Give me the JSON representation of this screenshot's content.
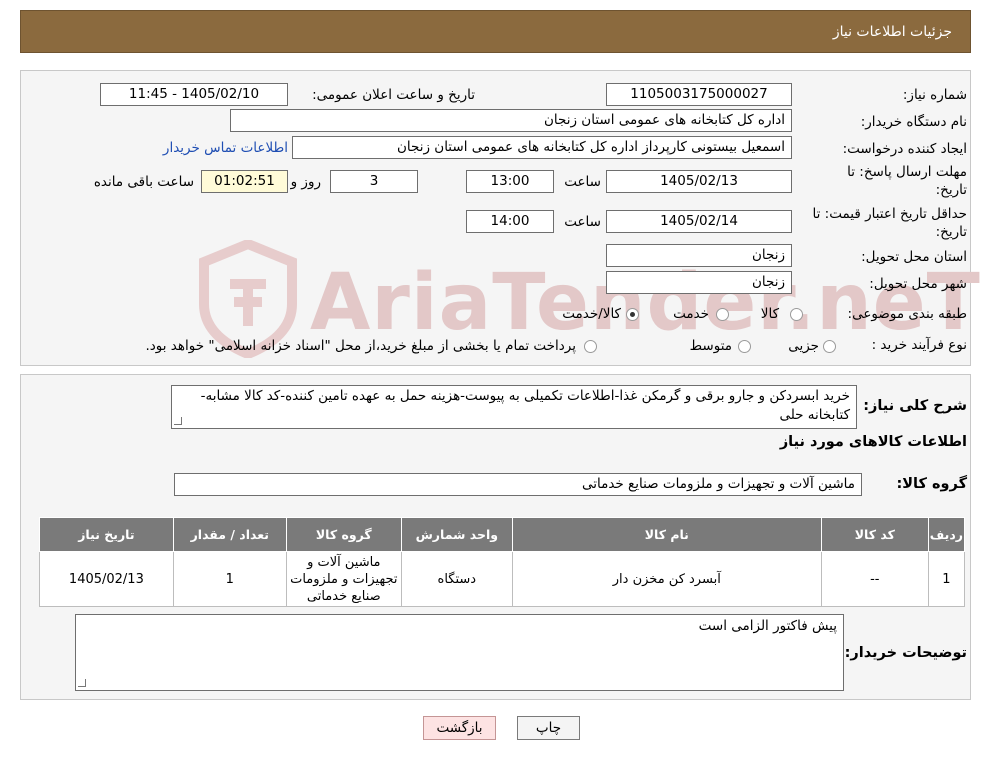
{
  "header": {
    "title": "جزئیات اطلاعات نیاز"
  },
  "watermark": {
    "text": "AriaTender.neT"
  },
  "form": {
    "need_number": {
      "label": "شماره نیاز:",
      "value": "1105003175000027"
    },
    "announce_datetime": {
      "label": "تاریخ و ساعت اعلان عمومی:",
      "value": "1405/02/10 - 11:45"
    },
    "buyer_org": {
      "label": "نام دستگاه خریدار:",
      "value": "اداره کل کتابخانه های عمومی استان زنجان"
    },
    "requester": {
      "label": "ایجاد کننده درخواست:",
      "value": "اسمعیل بیستونی کارپرداز اداره کل کتابخانه های عمومی استان زنجان",
      "contact_link": "اطلاعات تماس خریدار"
    },
    "reply_deadline": {
      "label_line1": "مهلت ارسال پاسخ: تا",
      "label_line2": "تاریخ:",
      "date": "1405/02/13",
      "time_label": "ساعت",
      "time": "13:00",
      "days": "3",
      "days_label": "روز و",
      "remaining": "01:02:51",
      "remaining_label": "ساعت باقی مانده"
    },
    "price_validity": {
      "label_line1": "حداقل تاریخ اعتبار قیمت: تا",
      "label_line2": "تاریخ:",
      "date": "1405/02/14",
      "time_label": "ساعت",
      "time": "14:00"
    },
    "delivery_province": {
      "label": "استان محل تحویل:",
      "value": "زنجان"
    },
    "delivery_city": {
      "label": "شهر محل تحویل:",
      "value": "زنجان"
    },
    "category": {
      "label": "طبقه بندی موضوعی:",
      "options": [
        "کالا",
        "خدمت",
        "کالا/خدمت"
      ],
      "selected": "کالا/خدمت"
    },
    "purchase_type": {
      "label": "نوع فرآیند خرید :",
      "options": [
        "جزیی",
        "متوسط"
      ],
      "selected": "none",
      "note": "پرداخت تمام یا بخشی از مبلغ خرید،از محل \"اسناد خزانه اسلامی\" خواهد بود."
    }
  },
  "description": {
    "label": "شرح کلی نیاز:",
    "text": "خرید ابسردکن و جارو برقی و گرمکن غذا-اطلاعات تکمیلی به پیوست-هزینه حمل به عهده تامین کننده-کد کالا مشابه-کتابخانه حلی"
  },
  "goods_section": {
    "title": "اطلاعات کالاهای مورد نیاز",
    "group_label": "گروه کالا:",
    "group_value": "ماشین آلات و تجهیزات و ملزومات صنایع خدماتی"
  },
  "table": {
    "headers": [
      "ردیف",
      "کد کالا",
      "نام کالا",
      "واحد شمارش",
      "گروه کالا",
      "تعداد / مقدار",
      "تاریخ نیاز"
    ],
    "rows": [
      [
        "1",
        "--",
        "آبسرد کن مخزن دار",
        "دستگاه",
        "ماشین آلات و تجهیزات و ملزومات صنایع خدماتی",
        "1",
        "1405/02/13"
      ]
    ]
  },
  "buyer_notes": {
    "label": "توضیحات خریدار:",
    "text": "پیش فاکتور الزامی است"
  },
  "buttons": {
    "print": "چاپ",
    "back": "بازگشت"
  }
}
